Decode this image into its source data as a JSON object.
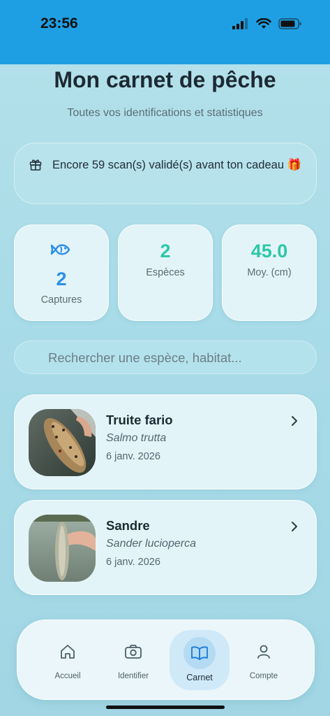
{
  "status": {
    "time": "23:56"
  },
  "header": {
    "title": "Mon carnet de pêche",
    "subtitle": "Toutes vos identifications et statistiques"
  },
  "promo": {
    "text": "Encore 59 scan(s) validé(s) avant ton cadeau 🎁"
  },
  "stats": [
    {
      "value": "2",
      "label": "Captures",
      "icon": "fish-icon"
    },
    {
      "value": "2",
      "label": "Espèces"
    },
    {
      "value": "45.0",
      "label": "Moy. (cm)"
    }
  ],
  "search": {
    "placeholder": "Rechercher une espèce, habitat..."
  },
  "catches": [
    {
      "name": "Truite fario",
      "latin": "Salmo trutta",
      "date": "6 janv. 2026"
    },
    {
      "name": "Sandre",
      "latin": "Sander lucioperca",
      "date": "6 janv. 2026"
    }
  ],
  "nav": {
    "items": [
      {
        "label": "Accueil",
        "icon": "home-icon"
      },
      {
        "label": "Identifier",
        "icon": "camera-icon"
      },
      {
        "label": "Carnet",
        "icon": "book-icon",
        "active": true
      },
      {
        "label": "Compte",
        "icon": "user-icon"
      }
    ]
  },
  "colors": {
    "status_bar": "#1f9fe3",
    "accent_blue": "#2a8fe8",
    "accent_teal": "#2cc7a8"
  }
}
